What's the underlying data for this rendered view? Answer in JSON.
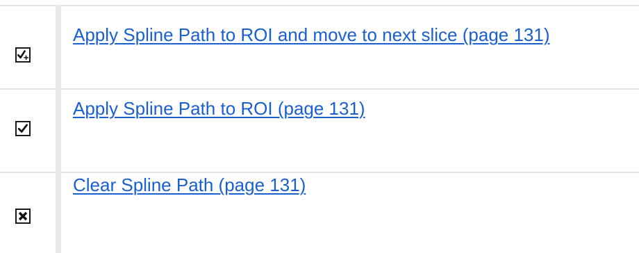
{
  "rows": [
    {
      "icon": "apply-and-next-icon",
      "link_text": "Apply Spline Path to ROI and move to next slice (page 131)"
    },
    {
      "icon": "check-icon",
      "link_text": "Apply Spline Path to ROI (page 131)"
    },
    {
      "icon": "clear-x-icon",
      "link_text": "Clear Spline Path (page 131)"
    }
  ],
  "colors": {
    "link": "#1a5fcf",
    "rule": "#e4e4e4",
    "icon_border": "#1a1a1a"
  }
}
